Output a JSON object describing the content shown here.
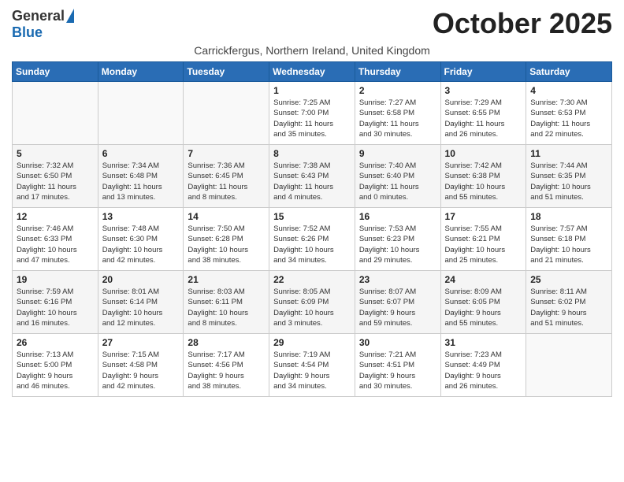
{
  "logo": {
    "general": "General",
    "blue": "Blue"
  },
  "title": "October 2025",
  "subtitle": "Carrickfergus, Northern Ireland, United Kingdom",
  "days_of_week": [
    "Sunday",
    "Monday",
    "Tuesday",
    "Wednesday",
    "Thursday",
    "Friday",
    "Saturday"
  ],
  "weeks": [
    [
      {
        "day": "",
        "info": ""
      },
      {
        "day": "",
        "info": ""
      },
      {
        "day": "",
        "info": ""
      },
      {
        "day": "1",
        "info": "Sunrise: 7:25 AM\nSunset: 7:00 PM\nDaylight: 11 hours\nand 35 minutes."
      },
      {
        "day": "2",
        "info": "Sunrise: 7:27 AM\nSunset: 6:58 PM\nDaylight: 11 hours\nand 30 minutes."
      },
      {
        "day": "3",
        "info": "Sunrise: 7:29 AM\nSunset: 6:55 PM\nDaylight: 11 hours\nand 26 minutes."
      },
      {
        "day": "4",
        "info": "Sunrise: 7:30 AM\nSunset: 6:53 PM\nDaylight: 11 hours\nand 22 minutes."
      }
    ],
    [
      {
        "day": "5",
        "info": "Sunrise: 7:32 AM\nSunset: 6:50 PM\nDaylight: 11 hours\nand 17 minutes."
      },
      {
        "day": "6",
        "info": "Sunrise: 7:34 AM\nSunset: 6:48 PM\nDaylight: 11 hours\nand 13 minutes."
      },
      {
        "day": "7",
        "info": "Sunrise: 7:36 AM\nSunset: 6:45 PM\nDaylight: 11 hours\nand 8 minutes."
      },
      {
        "day": "8",
        "info": "Sunrise: 7:38 AM\nSunset: 6:43 PM\nDaylight: 11 hours\nand 4 minutes."
      },
      {
        "day": "9",
        "info": "Sunrise: 7:40 AM\nSunset: 6:40 PM\nDaylight: 11 hours\nand 0 minutes."
      },
      {
        "day": "10",
        "info": "Sunrise: 7:42 AM\nSunset: 6:38 PM\nDaylight: 10 hours\nand 55 minutes."
      },
      {
        "day": "11",
        "info": "Sunrise: 7:44 AM\nSunset: 6:35 PM\nDaylight: 10 hours\nand 51 minutes."
      }
    ],
    [
      {
        "day": "12",
        "info": "Sunrise: 7:46 AM\nSunset: 6:33 PM\nDaylight: 10 hours\nand 47 minutes."
      },
      {
        "day": "13",
        "info": "Sunrise: 7:48 AM\nSunset: 6:30 PM\nDaylight: 10 hours\nand 42 minutes."
      },
      {
        "day": "14",
        "info": "Sunrise: 7:50 AM\nSunset: 6:28 PM\nDaylight: 10 hours\nand 38 minutes."
      },
      {
        "day": "15",
        "info": "Sunrise: 7:52 AM\nSunset: 6:26 PM\nDaylight: 10 hours\nand 34 minutes."
      },
      {
        "day": "16",
        "info": "Sunrise: 7:53 AM\nSunset: 6:23 PM\nDaylight: 10 hours\nand 29 minutes."
      },
      {
        "day": "17",
        "info": "Sunrise: 7:55 AM\nSunset: 6:21 PM\nDaylight: 10 hours\nand 25 minutes."
      },
      {
        "day": "18",
        "info": "Sunrise: 7:57 AM\nSunset: 6:18 PM\nDaylight: 10 hours\nand 21 minutes."
      }
    ],
    [
      {
        "day": "19",
        "info": "Sunrise: 7:59 AM\nSunset: 6:16 PM\nDaylight: 10 hours\nand 16 minutes."
      },
      {
        "day": "20",
        "info": "Sunrise: 8:01 AM\nSunset: 6:14 PM\nDaylight: 10 hours\nand 12 minutes."
      },
      {
        "day": "21",
        "info": "Sunrise: 8:03 AM\nSunset: 6:11 PM\nDaylight: 10 hours\nand 8 minutes."
      },
      {
        "day": "22",
        "info": "Sunrise: 8:05 AM\nSunset: 6:09 PM\nDaylight: 10 hours\nand 3 minutes."
      },
      {
        "day": "23",
        "info": "Sunrise: 8:07 AM\nSunset: 6:07 PM\nDaylight: 9 hours\nand 59 minutes."
      },
      {
        "day": "24",
        "info": "Sunrise: 8:09 AM\nSunset: 6:05 PM\nDaylight: 9 hours\nand 55 minutes."
      },
      {
        "day": "25",
        "info": "Sunrise: 8:11 AM\nSunset: 6:02 PM\nDaylight: 9 hours\nand 51 minutes."
      }
    ],
    [
      {
        "day": "26",
        "info": "Sunrise: 7:13 AM\nSunset: 5:00 PM\nDaylight: 9 hours\nand 46 minutes."
      },
      {
        "day": "27",
        "info": "Sunrise: 7:15 AM\nSunset: 4:58 PM\nDaylight: 9 hours\nand 42 minutes."
      },
      {
        "day": "28",
        "info": "Sunrise: 7:17 AM\nSunset: 4:56 PM\nDaylight: 9 hours\nand 38 minutes."
      },
      {
        "day": "29",
        "info": "Sunrise: 7:19 AM\nSunset: 4:54 PM\nDaylight: 9 hours\nand 34 minutes."
      },
      {
        "day": "30",
        "info": "Sunrise: 7:21 AM\nSunset: 4:51 PM\nDaylight: 9 hours\nand 30 minutes."
      },
      {
        "day": "31",
        "info": "Sunrise: 7:23 AM\nSunset: 4:49 PM\nDaylight: 9 hours\nand 26 minutes."
      },
      {
        "day": "",
        "info": ""
      }
    ]
  ]
}
